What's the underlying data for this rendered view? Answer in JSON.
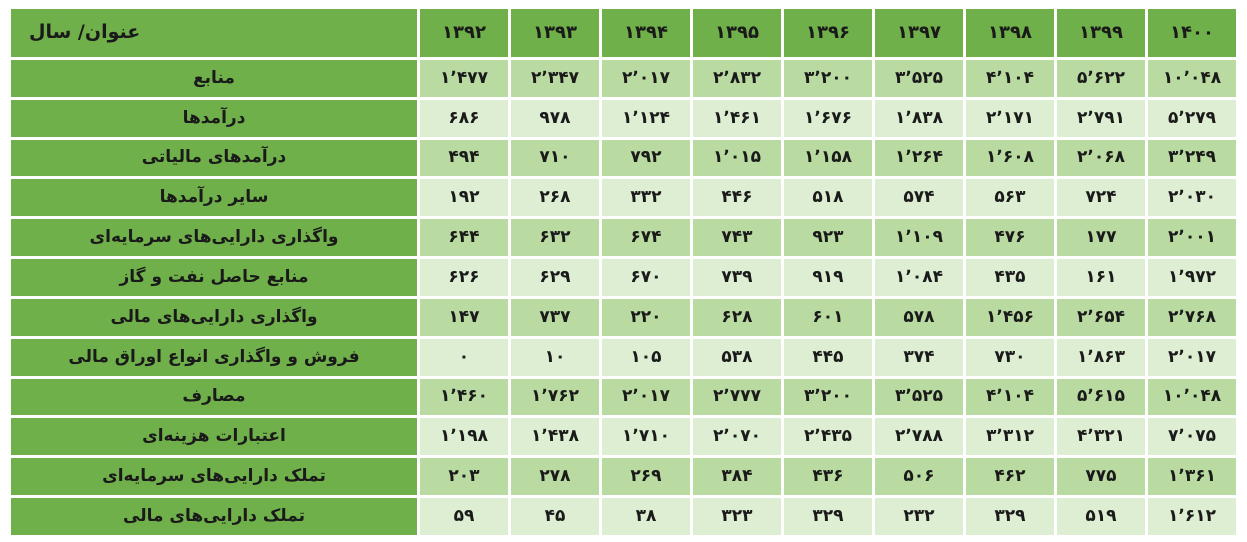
{
  "table": {
    "header_label": "عنوان/ سال",
    "years": [
      "۱۴۰۰",
      "۱۳۹۹",
      "۱۳۹۸",
      "۱۳۹۷",
      "۱۳۹۶",
      "۱۳۹۵",
      "۱۳۹۴",
      "۱۳۹۳",
      "۱۳۹۲"
    ],
    "rows": [
      {
        "label": "منابع",
        "values": [
          "۱۰٬۰۴۸",
          "۵٬۶۲۲",
          "۴٬۱۰۴",
          "۳٬۵۲۵",
          "۳٬۲۰۰",
          "۲٬۸۳۲",
          "۲٬۰۱۷",
          "۲٬۳۴۷",
          "۱٬۴۷۷"
        ]
      },
      {
        "label": "درآمدها",
        "values": [
          "۵٬۲۷۹",
          "۲٬۷۹۱",
          "۲٬۱۷۱",
          "۱٬۸۳۸",
          "۱٬۶۷۶",
          "۱٬۴۶۱",
          "۱٬۱۲۴",
          "۹۷۸",
          "۶۸۶"
        ]
      },
      {
        "label": "درآمدهای مالیاتی",
        "values": [
          "۳٬۲۴۹",
          "۲٬۰۶۸",
          "۱٬۶۰۸",
          "۱٬۲۶۴",
          "۱٬۱۵۸",
          "۱٬۰۱۵",
          "۷۹۲",
          "۷۱۰",
          "۴۹۴"
        ]
      },
      {
        "label": "سایر درآمدها",
        "values": [
          "۲٬۰۳۰",
          "۷۲۴",
          "۵۶۳",
          "۵۷۴",
          "۵۱۸",
          "۴۴۶",
          "۳۳۲",
          "۲۶۸",
          "۱۹۲"
        ]
      },
      {
        "label": "واگذاری دارایی‌های سرمایه‌ای",
        "values": [
          "۲٬۰۰۱",
          "۱۷۷",
          "۴۷۶",
          "۱٬۱۰۹",
          "۹۲۳",
          "۷۴۳",
          "۶۷۴",
          "۶۳۲",
          "۶۴۴"
        ]
      },
      {
        "label": "منابع حاصل نفت و گاز",
        "values": [
          "۱٬۹۷۲",
          "۱۶۱",
          "۴۳۵",
          "۱٬۰۸۴",
          "۹۱۹",
          "۷۳۹",
          "۶۷۰",
          "۶۲۹",
          "۶۲۶"
        ]
      },
      {
        "label": "واگذاری دارایی‌های مالی",
        "values": [
          "۲٬۷۶۸",
          "۲٬۶۵۴",
          "۱٬۴۵۶",
          "۵۷۸",
          "۶۰۱",
          "۶۲۸",
          "۲۲۰",
          "۷۳۷",
          "۱۴۷"
        ]
      },
      {
        "label": "فروش و واگذاری انواع اوراق مالی",
        "values": [
          "۲٬۰۱۷",
          "۱٬۸۶۳",
          "۷۳۰",
          "۳۷۴",
          "۴۴۵",
          "۵۳۸",
          "۱۰۵",
          "۱۰",
          "۰"
        ]
      },
      {
        "label": "مصارف",
        "values": [
          "۱۰٬۰۴۸",
          "۵٬۶۱۵",
          "۴٬۱۰۴",
          "۳٬۵۲۵",
          "۳٬۲۰۰",
          "۲٬۷۷۷",
          "۲٬۰۱۷",
          "۱٬۷۶۲",
          "۱٬۴۶۰"
        ]
      },
      {
        "label": "اعتبارات هزینه‌ای",
        "values": [
          "۷٬۰۷۵",
          "۴٬۳۲۱",
          "۳٬۳۱۲",
          "۲٬۷۸۸",
          "۲٬۴۳۵",
          "۲٬۰۷۰",
          "۱٬۷۱۰",
          "۱٬۴۳۸",
          "۱٬۱۹۸"
        ]
      },
      {
        "label": "تملک دارایی‌های سرمایه‌ای",
        "values": [
          "۱٬۳۶۱",
          "۷۷۵",
          "۴۶۲",
          "۵۰۶",
          "۴۳۶",
          "۳۸۴",
          "۲۶۹",
          "۲۷۸",
          "۲۰۳"
        ]
      },
      {
        "label": "تملک دارایی‌های مالی",
        "values": [
          "۱٬۶۱۲",
          "۵۱۹",
          "۳۲۹",
          "۲۳۲",
          "۳۲۹",
          "۳۲۳",
          "۳۸",
          "۴۵",
          "۵۹"
        ]
      }
    ]
  },
  "colors": {
    "header_green": "#6fb04a",
    "label_green": "#6fb04a",
    "band_dark": "#b9dba1",
    "band_light": "#ddeed2",
    "grid_white": "#ffffff",
    "text": "#1a1a1a"
  }
}
